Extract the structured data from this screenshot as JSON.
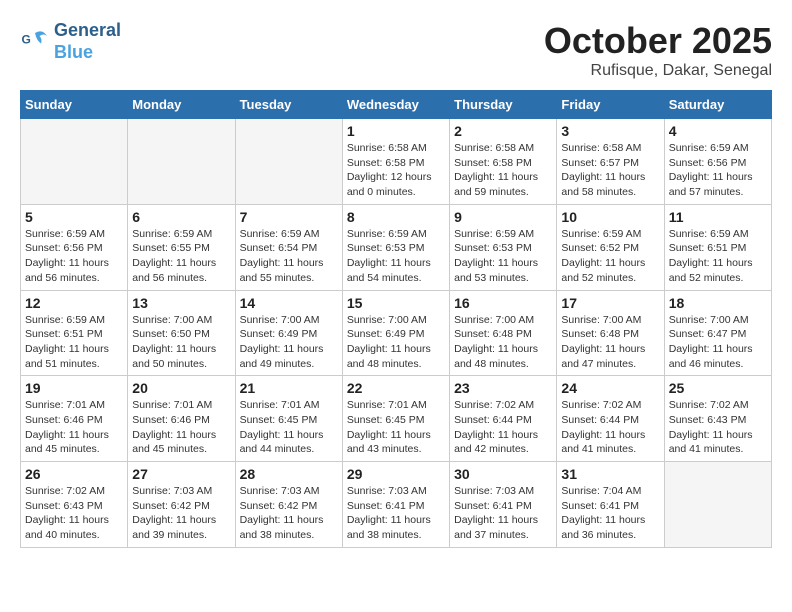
{
  "header": {
    "logo_line1": "General",
    "logo_line2": "Blue",
    "month": "October 2025",
    "location": "Rufisque, Dakar, Senegal"
  },
  "weekdays": [
    "Sunday",
    "Monday",
    "Tuesday",
    "Wednesday",
    "Thursday",
    "Friday",
    "Saturday"
  ],
  "weeks": [
    [
      {
        "day": "",
        "info": ""
      },
      {
        "day": "",
        "info": ""
      },
      {
        "day": "",
        "info": ""
      },
      {
        "day": "1",
        "info": "Sunrise: 6:58 AM\nSunset: 6:58 PM\nDaylight: 12 hours\nand 0 minutes."
      },
      {
        "day": "2",
        "info": "Sunrise: 6:58 AM\nSunset: 6:58 PM\nDaylight: 11 hours\nand 59 minutes."
      },
      {
        "day": "3",
        "info": "Sunrise: 6:58 AM\nSunset: 6:57 PM\nDaylight: 11 hours\nand 58 minutes."
      },
      {
        "day": "4",
        "info": "Sunrise: 6:59 AM\nSunset: 6:56 PM\nDaylight: 11 hours\nand 57 minutes."
      }
    ],
    [
      {
        "day": "5",
        "info": "Sunrise: 6:59 AM\nSunset: 6:56 PM\nDaylight: 11 hours\nand 56 minutes."
      },
      {
        "day": "6",
        "info": "Sunrise: 6:59 AM\nSunset: 6:55 PM\nDaylight: 11 hours\nand 56 minutes."
      },
      {
        "day": "7",
        "info": "Sunrise: 6:59 AM\nSunset: 6:54 PM\nDaylight: 11 hours\nand 55 minutes."
      },
      {
        "day": "8",
        "info": "Sunrise: 6:59 AM\nSunset: 6:53 PM\nDaylight: 11 hours\nand 54 minutes."
      },
      {
        "day": "9",
        "info": "Sunrise: 6:59 AM\nSunset: 6:53 PM\nDaylight: 11 hours\nand 53 minutes."
      },
      {
        "day": "10",
        "info": "Sunrise: 6:59 AM\nSunset: 6:52 PM\nDaylight: 11 hours\nand 52 minutes."
      },
      {
        "day": "11",
        "info": "Sunrise: 6:59 AM\nSunset: 6:51 PM\nDaylight: 11 hours\nand 52 minutes."
      }
    ],
    [
      {
        "day": "12",
        "info": "Sunrise: 6:59 AM\nSunset: 6:51 PM\nDaylight: 11 hours\nand 51 minutes."
      },
      {
        "day": "13",
        "info": "Sunrise: 7:00 AM\nSunset: 6:50 PM\nDaylight: 11 hours\nand 50 minutes."
      },
      {
        "day": "14",
        "info": "Sunrise: 7:00 AM\nSunset: 6:49 PM\nDaylight: 11 hours\nand 49 minutes."
      },
      {
        "day": "15",
        "info": "Sunrise: 7:00 AM\nSunset: 6:49 PM\nDaylight: 11 hours\nand 48 minutes."
      },
      {
        "day": "16",
        "info": "Sunrise: 7:00 AM\nSunset: 6:48 PM\nDaylight: 11 hours\nand 48 minutes."
      },
      {
        "day": "17",
        "info": "Sunrise: 7:00 AM\nSunset: 6:48 PM\nDaylight: 11 hours\nand 47 minutes."
      },
      {
        "day": "18",
        "info": "Sunrise: 7:00 AM\nSunset: 6:47 PM\nDaylight: 11 hours\nand 46 minutes."
      }
    ],
    [
      {
        "day": "19",
        "info": "Sunrise: 7:01 AM\nSunset: 6:46 PM\nDaylight: 11 hours\nand 45 minutes."
      },
      {
        "day": "20",
        "info": "Sunrise: 7:01 AM\nSunset: 6:46 PM\nDaylight: 11 hours\nand 45 minutes."
      },
      {
        "day": "21",
        "info": "Sunrise: 7:01 AM\nSunset: 6:45 PM\nDaylight: 11 hours\nand 44 minutes."
      },
      {
        "day": "22",
        "info": "Sunrise: 7:01 AM\nSunset: 6:45 PM\nDaylight: 11 hours\nand 43 minutes."
      },
      {
        "day": "23",
        "info": "Sunrise: 7:02 AM\nSunset: 6:44 PM\nDaylight: 11 hours\nand 42 minutes."
      },
      {
        "day": "24",
        "info": "Sunrise: 7:02 AM\nSunset: 6:44 PM\nDaylight: 11 hours\nand 41 minutes."
      },
      {
        "day": "25",
        "info": "Sunrise: 7:02 AM\nSunset: 6:43 PM\nDaylight: 11 hours\nand 41 minutes."
      }
    ],
    [
      {
        "day": "26",
        "info": "Sunrise: 7:02 AM\nSunset: 6:43 PM\nDaylight: 11 hours\nand 40 minutes."
      },
      {
        "day": "27",
        "info": "Sunrise: 7:03 AM\nSunset: 6:42 PM\nDaylight: 11 hours\nand 39 minutes."
      },
      {
        "day": "28",
        "info": "Sunrise: 7:03 AM\nSunset: 6:42 PM\nDaylight: 11 hours\nand 38 minutes."
      },
      {
        "day": "29",
        "info": "Sunrise: 7:03 AM\nSunset: 6:41 PM\nDaylight: 11 hours\nand 38 minutes."
      },
      {
        "day": "30",
        "info": "Sunrise: 7:03 AM\nSunset: 6:41 PM\nDaylight: 11 hours\nand 37 minutes."
      },
      {
        "day": "31",
        "info": "Sunrise: 7:04 AM\nSunset: 6:41 PM\nDaylight: 11 hours\nand 36 minutes."
      },
      {
        "day": "",
        "info": ""
      }
    ]
  ]
}
